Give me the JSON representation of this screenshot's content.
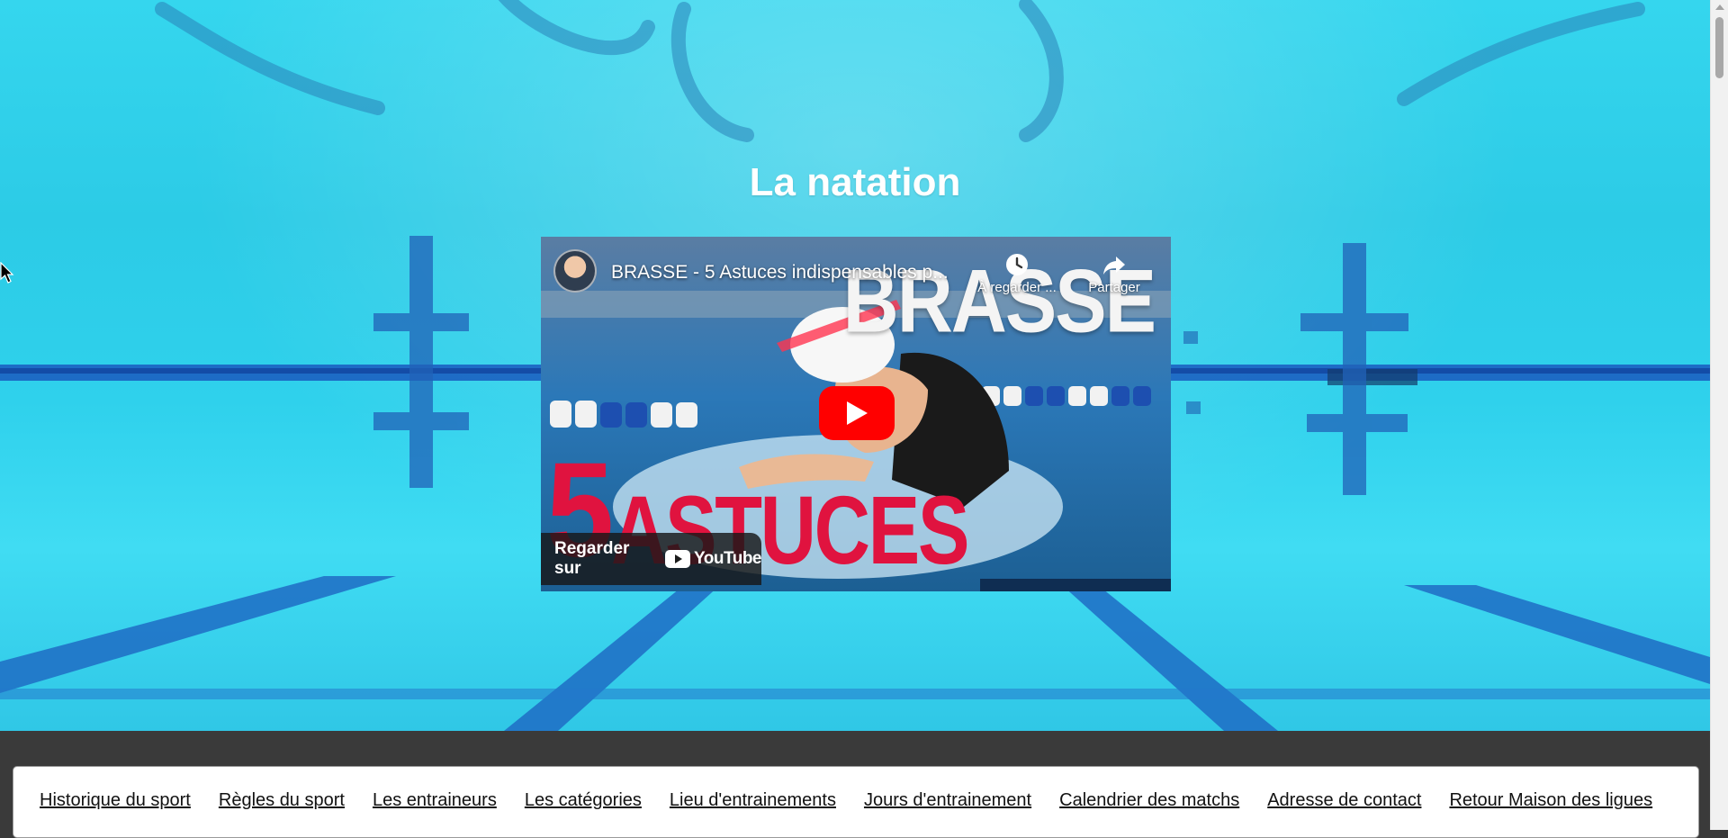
{
  "page": {
    "title": "La natation"
  },
  "video": {
    "title": "BRASSE - 5 Astuces indispensables p...",
    "watch_later_label": "À regarder ...",
    "share_label": "Partager",
    "thumbnail_word": "BRASSE",
    "thumbnail_number": "5",
    "thumbnail_tagline": "ASTUCES",
    "watch_on_label": "Regarder sur",
    "platform_name": "YouTube"
  },
  "nav": {
    "items": [
      {
        "label": "Historique du sport"
      },
      {
        "label": "Règles du sport"
      },
      {
        "label": "Les entraineurs"
      },
      {
        "label": "Les catégories"
      },
      {
        "label": "Lieu d'entrainements"
      },
      {
        "label": "Jours d'entrainement"
      },
      {
        "label": "Calendrier des matchs"
      },
      {
        "label": "Adresse de contact"
      },
      {
        "label": "Retour Maison des ligues"
      }
    ]
  },
  "colors": {
    "pool_water": "#2ccbe6",
    "footer_bg": "#3a3a3a",
    "youtube_red": "#ff0000",
    "tagline_red": "#e0133f"
  }
}
